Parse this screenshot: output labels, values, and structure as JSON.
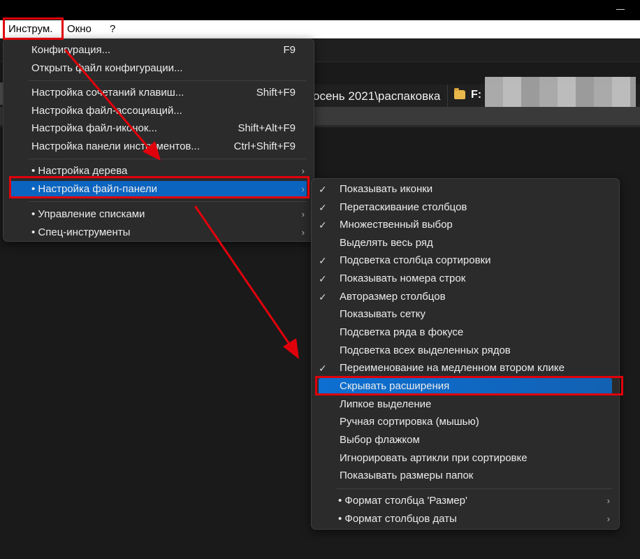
{
  "menubar": {
    "items": [
      "Инструм.",
      "Окно",
      "?"
    ]
  },
  "background": {
    "path_text": "осень 2021\\распаковка",
    "drive_text": "F:"
  },
  "main_menu": {
    "items": [
      {
        "label": "Конфигурация...",
        "shortcut": "F9"
      },
      {
        "label": "Открыть файл конфигурации...",
        "shortcut": ""
      },
      {
        "label": "Настройка сочетаний клавиш...",
        "shortcut": "Shift+F9"
      },
      {
        "label": "Настройка файл-ассоциаций...",
        "shortcut": ""
      },
      {
        "label": "Настройка файл-иконок...",
        "shortcut": "Shift+Alt+F9"
      },
      {
        "label": "Настройка панели инструментов...",
        "shortcut": "Ctrl+Shift+F9"
      },
      {
        "label": "• Настройка дерева",
        "submenu": true
      },
      {
        "label": "• Настройка файл-панели",
        "submenu": true,
        "highlighted": true
      },
      {
        "label": "• Управление списками",
        "submenu": true
      },
      {
        "label": "• Спец-инструменты",
        "submenu": true
      }
    ]
  },
  "submenu": {
    "items": [
      {
        "label": "Показывать иконки",
        "checked": true
      },
      {
        "label": "Перетаскивание столбцов",
        "checked": true
      },
      {
        "label": "Множественный выбор",
        "checked": true
      },
      {
        "label": "Выделять весь ряд",
        "checked": false
      },
      {
        "label": "Подсветка столбца сортировки",
        "checked": true
      },
      {
        "label": "Показывать номера строк",
        "checked": true
      },
      {
        "label": "Авторазмер столбцов",
        "checked": true
      },
      {
        "label": "Показывать сетку",
        "checked": false
      },
      {
        "label": "Подсветка ряда в фокусе",
        "checked": false
      },
      {
        "label": "Подсветка всех выделенных рядов",
        "checked": false
      },
      {
        "label": "Переименование на медленном втором клике",
        "checked": true
      },
      {
        "label": "Скрывать расширения",
        "checked": false,
        "highlighted": true
      },
      {
        "label": "Липкое выделение",
        "checked": false
      },
      {
        "label": "Ручная сортировка (мышью)",
        "checked": false
      },
      {
        "label": "Выбор флажком",
        "checked": false
      },
      {
        "label": "Игнорировать артикли при сортировке",
        "checked": false
      },
      {
        "label": "Показывать размеры папок",
        "checked": false
      },
      {
        "label": "• Формат столбца 'Размер'",
        "submenu": true
      },
      {
        "label": "• Формат столбцов даты",
        "submenu": true
      }
    ]
  },
  "icons": {
    "check": "check-icon",
    "submenu_arrow": "chevron-right-icon",
    "folder": "folder-icon"
  },
  "colors": {
    "highlight": "#0a64c0",
    "annotation_red": "#e0000b",
    "menu_bg": "#2b2b2b"
  }
}
